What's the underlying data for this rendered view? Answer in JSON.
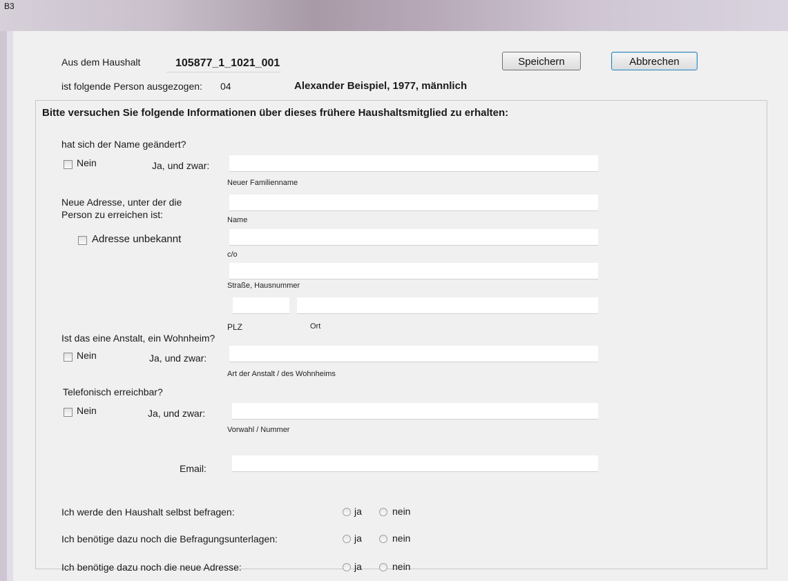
{
  "window": {
    "title": "B3"
  },
  "header": {
    "household_label": "Aus dem Haushalt",
    "household_id": "105877_1_1021_001",
    "moved_label": "ist folgende Person ausgezogen:",
    "person_number": "04",
    "person_info": "Alexander Beispiel, 1977, männlich",
    "save_label": "Speichern",
    "cancel_label": "Abbrechen"
  },
  "group": {
    "heading": "Bitte versuchen Sie folgende Informationen über dieses frühere Haushaltsmitglied zu erhalten:"
  },
  "name_change": {
    "question": "hat sich der Name geändert?",
    "no_label": "Nein",
    "yes_label": "Ja, und zwar:",
    "field_value": "",
    "field_caption": "Neuer Familienname"
  },
  "address": {
    "question_line1": "Neue Adresse, unter der die",
    "question_line2": "Person zu erreichen ist:",
    "unknown_label": "Adresse unbekannt",
    "name_caption": "Name",
    "co_caption": "c/o",
    "street_caption": "Straße, Hausnummer",
    "plz_caption": "PLZ",
    "ort_caption": "Ort",
    "name_value": "",
    "co_value": "",
    "street_value": "",
    "plz_value": "",
    "ort_value": ""
  },
  "institution": {
    "question": "Ist das eine Anstalt, ein Wohnheim?",
    "no_label": "Nein",
    "yes_label": "Ja, und zwar:",
    "field_value": "",
    "field_caption": "Art der Anstalt / des Wohnheims"
  },
  "phone": {
    "question": "Telefonisch erreichbar?",
    "no_label": "Nein",
    "yes_label": "Ja, und zwar:",
    "field_value": "",
    "field_caption": "Vorwahl / Nummer"
  },
  "email": {
    "label": "Email:",
    "value": ""
  },
  "questions": [
    {
      "text": "Ich werde den Haushalt selbst befragen:",
      "yes": "ja",
      "no": "nein"
    },
    {
      "text": "Ich benötige dazu noch die Befragungsunterlagen:",
      "yes": "ja",
      "no": "nein"
    },
    {
      "text": "Ich benötige dazu noch die neue Adresse:",
      "yes": "ja",
      "no": "nein"
    }
  ]
}
